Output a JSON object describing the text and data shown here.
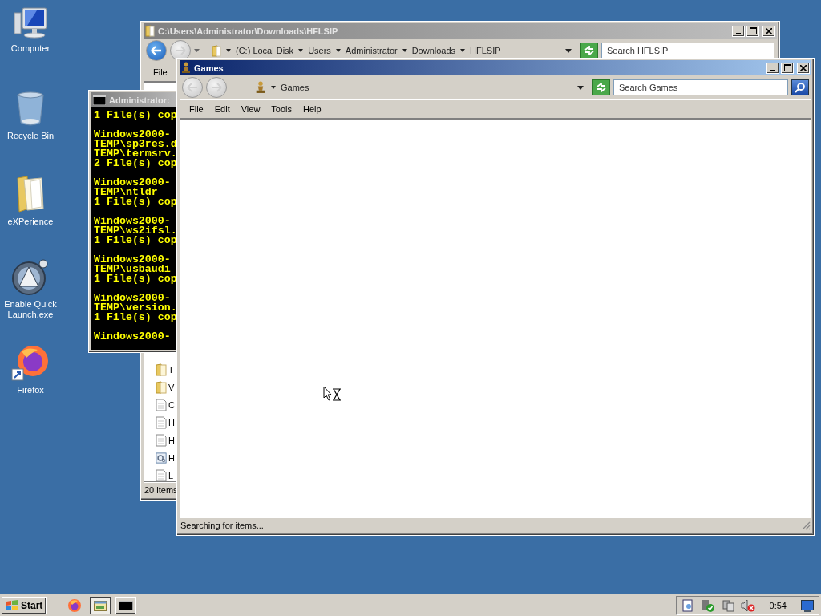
{
  "desktop_icons": [
    {
      "label": "Computer",
      "kind": "computer"
    },
    {
      "label": "Recycle Bin",
      "kind": "bin"
    },
    {
      "label": "eXPerience",
      "kind": "folder"
    },
    {
      "label": "Enable Quick Launch.exe",
      "kind": "app"
    },
    {
      "label": "Firefox",
      "kind": "firefox"
    }
  ],
  "explorer_window": {
    "title": "C:\\Users\\Administrator\\Downloads\\HFLSIP",
    "active": false,
    "breadcrumb": [
      "(C:) Local Disk",
      "Users",
      "Administrator",
      "Downloads",
      "HFLSIP"
    ],
    "search": {
      "placeholder": "Search HFLSIP"
    },
    "menu": [
      "File"
    ],
    "files": [
      {
        "label": "T",
        "kind": "folder"
      },
      {
        "label": "V",
        "kind": "folder"
      },
      {
        "label": "C",
        "kind": "file"
      },
      {
        "label": "H",
        "kind": "file"
      },
      {
        "label": "H",
        "kind": "file"
      },
      {
        "label": "H",
        "kind": "settings"
      },
      {
        "label": "L",
        "kind": "file"
      }
    ],
    "status": "20 items"
  },
  "console_window": {
    "title": "Administrator:",
    "active": false,
    "blocks": [
      [
        "1 File(s) cop"
      ],
      [
        "Windows2000-",
        "TEMP\\sp3res.d",
        "TEMP\\termsrv.",
        "2 File(s) cop"
      ],
      [
        "Windows2000-",
        "TEMP\\ntldr",
        "1 File(s) cop"
      ],
      [
        "Windows2000-",
        "TEMP\\ws2ifsl.",
        "1 File(s) cop"
      ],
      [
        "Windows2000-",
        "TEMP\\usbaudi",
        "1 File(s) cop"
      ],
      [
        "Windows2000-",
        "TEMP\\version.",
        "1 File(s) cop"
      ],
      [
        "Windows2000-"
      ]
    ]
  },
  "games_window": {
    "title": "Games",
    "active": true,
    "address": "Games",
    "search": {
      "placeholder": "Search Games"
    },
    "menu": [
      "File",
      "Edit",
      "View",
      "Tools",
      "Help"
    ],
    "status": "Searching for items..."
  },
  "taskbar": {
    "start": "Start",
    "items": [
      {
        "kind": "firefox"
      },
      {
        "kind": "explorer",
        "selected": true
      },
      {
        "kind": "console",
        "selected": false
      }
    ],
    "clock": "0:54"
  }
}
